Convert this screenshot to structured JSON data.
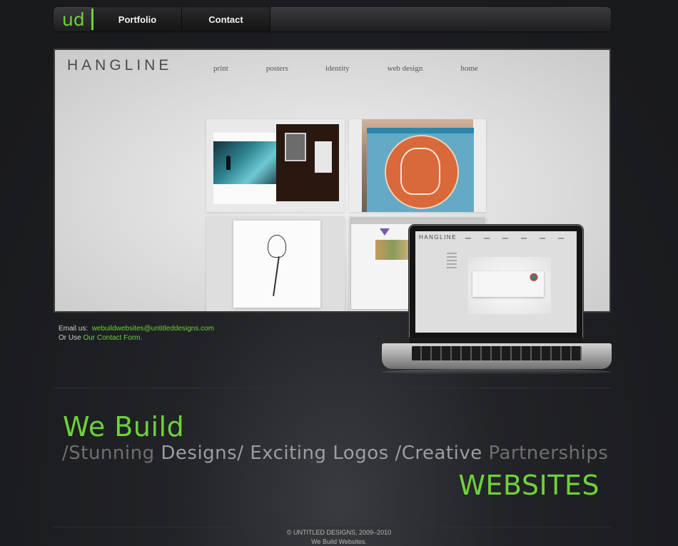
{
  "nav": {
    "logo": "ud",
    "items": [
      {
        "label": "Portfolio"
      },
      {
        "label": "Contact"
      }
    ]
  },
  "showcase": {
    "site_title": "HANGLINE",
    "site_nav": [
      "print",
      "posters",
      "identity",
      "web design",
      "home"
    ],
    "laptop_title": "HANGLINE"
  },
  "contact": {
    "email_prefix": "Email us:",
    "email": "webuildwebsites@untitleddesigns.com",
    "or_use": "Or Use",
    "form_link": "Our Contact Form."
  },
  "tagline": {
    "we_build": "We Build",
    "phrases": [
      {
        "text": "/Stunning",
        "style": "dim"
      },
      {
        "text": "Designs/",
        "style": "hl"
      },
      {
        "text": "Exciting",
        "style": "hl"
      },
      {
        "text": "Logos",
        "style": "hl"
      },
      {
        "text": "/Creative",
        "style": "hl"
      },
      {
        "text": "Partnerships",
        "style": "dim"
      }
    ],
    "websites": "WEBSITES"
  },
  "footer": {
    "copyright": "© UNTITLED DESIGNS, 2009–2010",
    "slogan": "We Build Websites."
  },
  "colors": {
    "accent": "#6ed23a",
    "background": "#1b1c1f",
    "nav": "#1f1f21"
  }
}
